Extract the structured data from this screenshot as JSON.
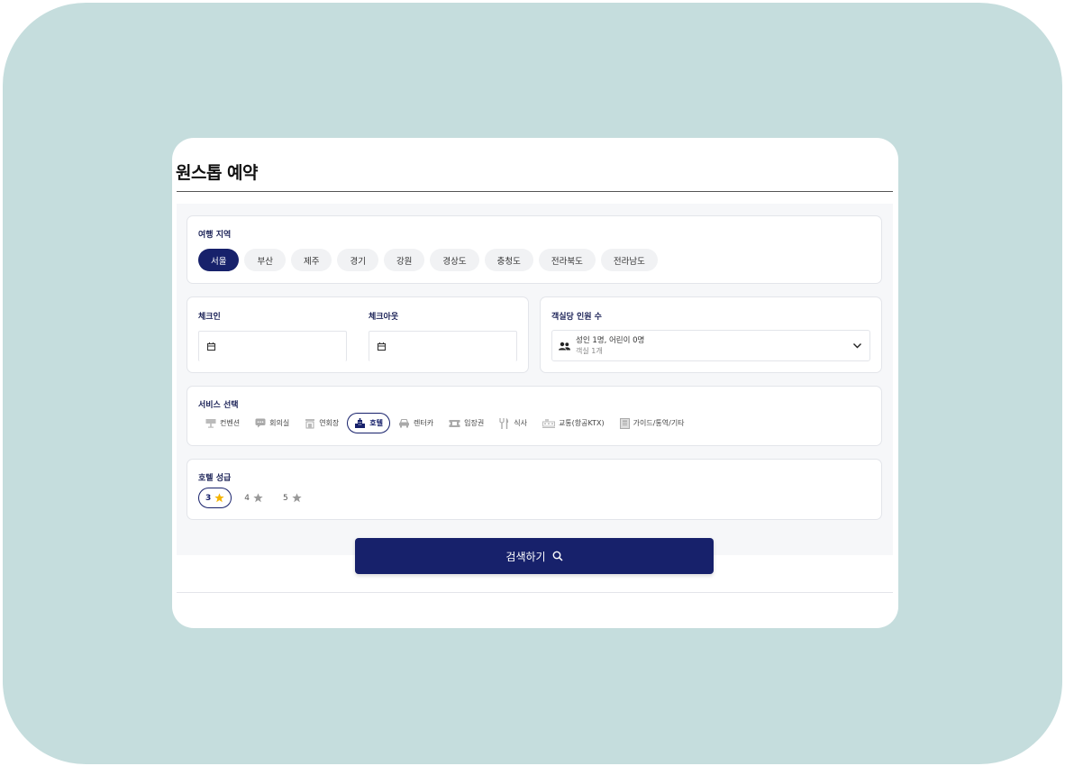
{
  "page": {
    "title": "원스톱 예약"
  },
  "region": {
    "label": "여행 지역",
    "options": [
      "서울",
      "부산",
      "제주",
      "경기",
      "강원",
      "경상도",
      "충청도",
      "전라북도",
      "전라남도"
    ],
    "selected": "서울"
  },
  "dates": {
    "checkin_label": "체크인",
    "checkout_label": "체크아웃",
    "checkin_value": "",
    "checkout_value": ""
  },
  "guests": {
    "label": "객실당 인원 수",
    "summary": "성인 1명, 어린이 0명",
    "rooms": "객실 1개"
  },
  "services": {
    "label": "서비스 선택",
    "items": [
      {
        "label": "컨벤션",
        "icon": "convention-icon"
      },
      {
        "label": "회의실",
        "icon": "meeting-room-icon"
      },
      {
        "label": "연회장",
        "icon": "banquet-hall-icon"
      },
      {
        "label": "호텔",
        "icon": "hotel-icon"
      },
      {
        "label": "렌터카",
        "icon": "car-icon"
      },
      {
        "label": "입장권",
        "icon": "ticket-icon"
      },
      {
        "label": "식사",
        "icon": "meal-icon"
      },
      {
        "label": "교통(항공KTX)",
        "icon": "transport-icon"
      },
      {
        "label": "가이드/통역/기타",
        "icon": "guide-icon"
      }
    ],
    "selected": "호텔"
  },
  "hotel_grade": {
    "label": "호텔 성급",
    "options": [
      "3",
      "4",
      "5"
    ],
    "selected": "3"
  },
  "search": {
    "label": "검색하기"
  },
  "colors": {
    "accent": "#17216b",
    "background": "#c5dddd",
    "star_active": "#f5b400",
    "star_inactive": "#999999"
  }
}
